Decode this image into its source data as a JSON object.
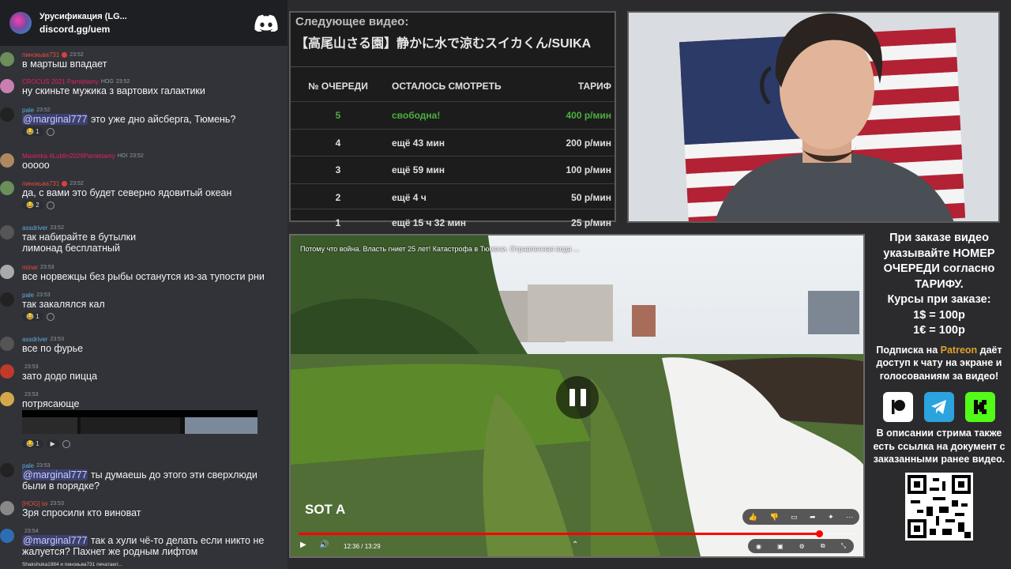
{
  "chat": {
    "server_name": "Урусификация (LG...",
    "server_link": "discord.gg/uem",
    "messages": [
      {
        "author": "пинокьва731",
        "time": "23:52",
        "color": "#e74c3c",
        "text": "в мартыш впадает"
      },
      {
        "author": "CROCUS 2021 Pamiętamy",
        "tag": "HOG",
        "time": "23:52",
        "color": "#e91e63",
        "text": "ну скиньте мужика з вартових галактики"
      },
      {
        "author": "pale",
        "time": "23:52",
        "color": "#5dade2",
        "mention": "@marginal777",
        "text": " это уже дно айсберга, Тюмень?",
        "reaction": "1"
      },
      {
        "author": "Maximka #Lublin2026Pamietamy",
        "tag": "HOI",
        "time": "23:52",
        "color": "#e91e63",
        "text": "ооооо"
      },
      {
        "author": "пинокьва731",
        "time": "23:52",
        "color": "#e74c3c",
        "text": "да, с вами это будет северно ядовитый океан",
        "reaction": "2"
      },
      {
        "author": "assdriver",
        "time": "23:52",
        "color": "#5dade2",
        "text": "так набирайте в бутылки\nлимонад бесплатный"
      },
      {
        "author": "minar",
        "time": "23:53",
        "color": "#e74c3c",
        "text": "все норвежцы без рыбы останутся из-за тупости рни"
      },
      {
        "author": "pale",
        "time": "23:53",
        "color": "#5dade2",
        "text": "так закалялся кал",
        "reaction": "1"
      },
      {
        "author": "assdriver",
        "time": "23:53",
        "color": "#5dade2",
        "text": "все по фурье"
      },
      {
        "author": "",
        "time": "23:53",
        "color": "#949ba4",
        "text": "зато додо пицца"
      },
      {
        "author": "",
        "time": "23:53",
        "color": "#949ba4",
        "text": "потрясающе",
        "reaction": "1"
      },
      {
        "author": "pale",
        "time": "23:53",
        "color": "#5dade2",
        "mention": "@marginal777",
        "text": " ты думаешь до этого эти сверхлюди\nбыли в порядке?"
      },
      {
        "author": "[HOG] iw",
        "time": "23:53",
        "color": "#e74c3c",
        "text": "Зря спросили кто виноват"
      },
      {
        "author": "",
        "time": "23:54",
        "color": "#949ba4",
        "mention": "@marginal777",
        "text": " так а хули чё-то делать если никто не\nжалуется? Пахнет же родным лифтом"
      }
    ],
    "typing": "Shakshuka1984 и пинокьва731 печатают..."
  },
  "queue": {
    "label": "Следующее видео:",
    "next_title": "【高尾山さる園】静かに水で涼むスイカくん/SUIKA",
    "headers": [
      "№ ОЧЕРЕДИ",
      "ОСТАЛОСЬ СМОТРЕТЬ",
      "ТАРИФ"
    ],
    "rows": [
      {
        "num": "5",
        "remaining": "свободна!",
        "rate": "400 р/мин"
      },
      {
        "num": "4",
        "remaining": "ещё 43 мин",
        "rate": "200 р/мин"
      },
      {
        "num": "3",
        "remaining": "ещё 59 мин",
        "rate": "100 р/мин"
      },
      {
        "num": "2",
        "remaining": "ещё 4 ч",
        "rate": "50 р/мин"
      },
      {
        "num": "1",
        "remaining": "ещё 15 ч 32 мин",
        "rate": "25 р/мин"
      }
    ]
  },
  "video": {
    "title": "Потому что война. Власть гниет 25 лет! Катастрофа в Тюмени. Отравленная вода ...",
    "time": "12:36 / 13:29",
    "progress": 0.9345,
    "watermark": "SOT A"
  },
  "info": {
    "order_text": "При заказе видео указывайте НОМЕР ОЧЕРЕДИ согласно ТАРИФУ.",
    "rates_title": "Курсы при заказе:",
    "rate_usd": "1$ = 100р",
    "rate_eur": "1€ = 100р",
    "sub_prefix": "Подписка на ",
    "sub_patreon": "Patreon",
    "sub_suffix": " даёт доступ к чату на экране и голосованиям за видео!",
    "desc": "В описании стрима также есть ссылка на документ с заказанными ранее видео.",
    "colors": {
      "patreon": "#e0a126",
      "telegram": "#2aa3df",
      "kick": "#53fc18"
    }
  }
}
